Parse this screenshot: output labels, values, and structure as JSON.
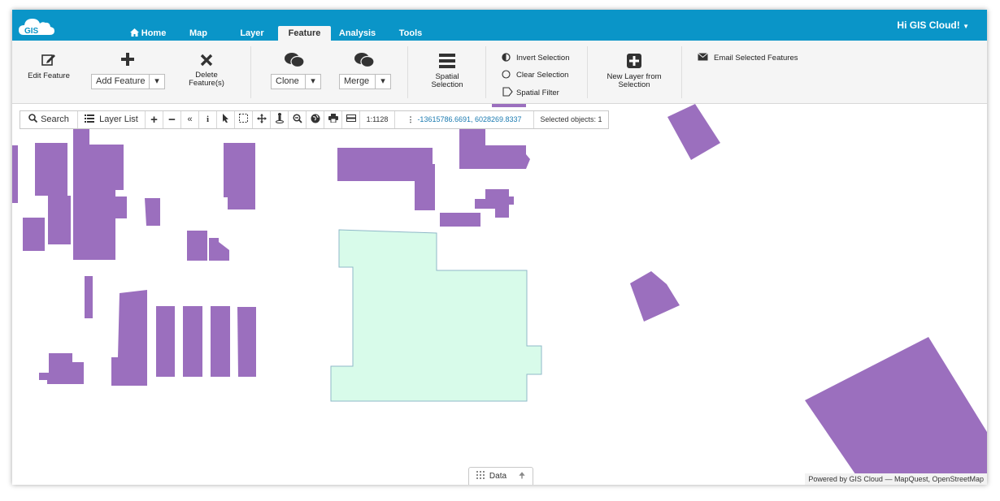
{
  "app": {
    "logo_text": "GIS",
    "greeting": "Hi GIS Cloud!",
    "accent_color": "#0a95c8"
  },
  "tabs": [
    {
      "label": "Home",
      "icon": "home-icon"
    },
    {
      "label": "Map"
    },
    {
      "label": "Layer"
    },
    {
      "label": "Feature",
      "active": true
    },
    {
      "label": "Analysis"
    },
    {
      "label": "Tools"
    }
  ],
  "ribbon": {
    "edit_feature": "Edit Feature",
    "add_feature": "Add Feature",
    "delete_feature_line1": "Delete",
    "delete_feature_line2": "Feature(s)",
    "clone": "Clone",
    "merge": "Merge",
    "spatial_selection_line1": "Spatial",
    "spatial_selection_line2": "Selection",
    "invert_selection": "Invert Selection",
    "clear_selection": "Clear Selection",
    "spatial_filter": "Spatial Filter",
    "new_layer_line1": "New Layer from",
    "new_layer_line2": "Selection",
    "email_selected": "Email Selected Features"
  },
  "map_toolbar": {
    "search": "Search",
    "layer_list": "Layer List",
    "scale": "1:1128",
    "coordinates": "-13615786.6691, 6028269.8337",
    "selected_objects": "Selected objects: 1"
  },
  "data_panel": {
    "label": "Data"
  },
  "attribution": {
    "prefix": "Powered by",
    "brand": "GIS Cloud",
    "rest": "— MapQuest, OpenStreetMap"
  },
  "colors": {
    "building": "#9b6fbe",
    "selected_fill": "#d8fbea",
    "selected_stroke": "#8fb8c8"
  }
}
